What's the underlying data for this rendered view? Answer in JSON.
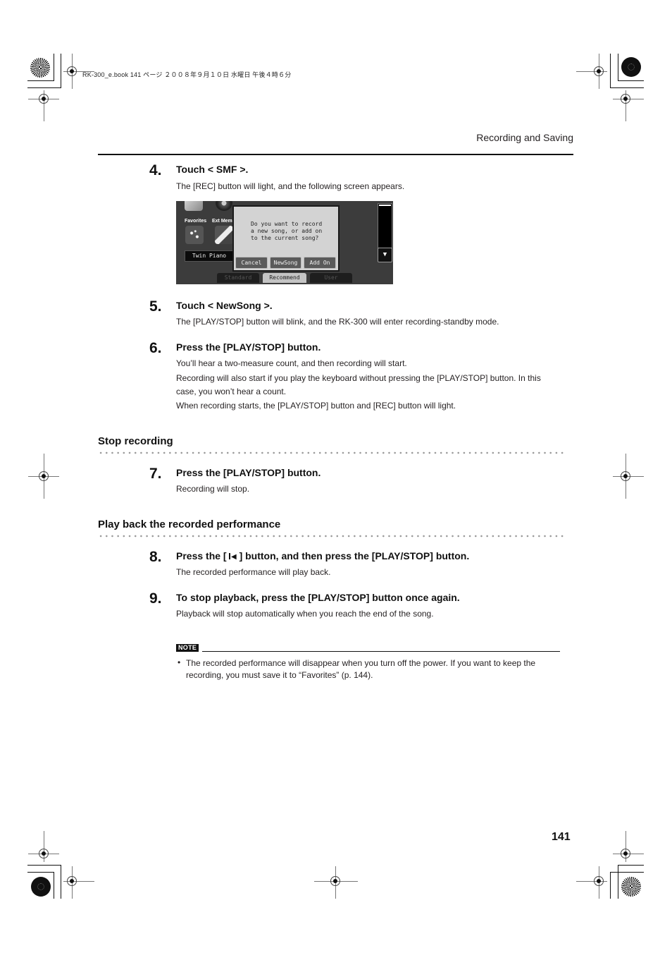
{
  "print_slug": "RK-300_e.book  141 ページ  ２００８年９月１０日  水曜日  午後４時６分",
  "header": {
    "section_title": "Recording and Saving"
  },
  "steps": [
    {
      "number": "4.",
      "title": "Touch < SMF >.",
      "body": [
        "The [REC] button will light, and the following screen appears."
      ]
    },
    {
      "number": "5.",
      "title": "Touch < NewSong >.",
      "body": [
        "The [PLAY/STOP] button will blink, and the RK-300 will enter recording-standby mode."
      ]
    },
    {
      "number": "6.",
      "title": "Press the [PLAY/STOP] button.",
      "body": [
        "You’ll hear a two-measure count, and then recording will start.",
        "Recording will also start if you play the keyboard without pressing the [PLAY/STOP] button. In this case, you won’t hear a count.",
        "When recording starts, the [PLAY/STOP] button and [REC] button will light."
      ]
    },
    {
      "number": "7.",
      "title": "Press the [PLAY/STOP] button.",
      "body": [
        "Recording will stop."
      ]
    },
    {
      "number": "8.",
      "title_before_icon": "Press the [ ",
      "icon": "skip-to-start-icon",
      "title_after_icon": " ] button, and then press the [PLAY/STOP] button.",
      "body": [
        "The recorded performance will play back."
      ]
    },
    {
      "number": "9.",
      "title": "To stop playback, press the [PLAY/STOP] button once again.",
      "body": [
        "Playback will stop automatically when you reach the end of the song."
      ]
    }
  ],
  "sections": [
    {
      "title": "Stop recording"
    },
    {
      "title": "Play back the recorded performance"
    }
  ],
  "screen": {
    "icons": [
      {
        "label": "Favorites",
        "icon": "sparkles-icon"
      },
      {
        "label": "Ext Memo",
        "icon": "usb-memory-icon"
      }
    ],
    "tone_name": "Twin Piano",
    "dialog": {
      "message": "Do you want to record\na new song, or add on\nto the current song?",
      "buttons": [
        "Cancel",
        "NewSong",
        "Add On"
      ]
    },
    "tabs": [
      {
        "label": "Standard",
        "active": false
      },
      {
        "label": "Recommend",
        "active": true
      },
      {
        "label": "User",
        "active": false
      }
    ],
    "scroll_down_glyph": "▼"
  },
  "note": {
    "badge": "NOTE",
    "bullet": "•",
    "text": "The recorded performance will disappear when you turn off the power. If you want to keep the recording, you must save it to “Favorites” (p. 144)."
  },
  "page_number": "141",
  "skip_glyph": "◀"
}
